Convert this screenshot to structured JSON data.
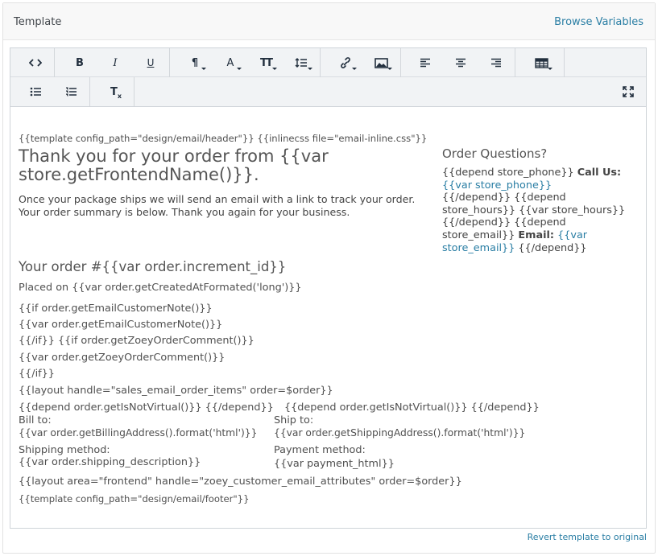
{
  "panel": {
    "title": "Template",
    "browse_variables": "Browse Variables",
    "revert_link": "Revert template to original"
  },
  "toolbar": {
    "row1": [
      {
        "name": "source-code-icon",
        "glyph": "<>"
      },
      {
        "name": "bold-icon",
        "glyph": "B"
      },
      {
        "name": "italic-icon",
        "glyph": "I"
      },
      {
        "name": "underline-icon",
        "glyph": "U"
      },
      {
        "name": "paragraph-format-icon",
        "glyph": "¶"
      },
      {
        "name": "font-color-icon",
        "glyph": "A"
      },
      {
        "name": "font-size-icon",
        "glyph": "TT"
      },
      {
        "name": "line-height-icon",
        "glyph": "≡"
      },
      {
        "name": "link-icon",
        "glyph": "link"
      },
      {
        "name": "image-icon",
        "glyph": "image"
      },
      {
        "name": "align-left-icon",
        "glyph": "align-left"
      },
      {
        "name": "align-center-icon",
        "glyph": "align-center"
      },
      {
        "name": "align-right-icon",
        "glyph": "align-right"
      },
      {
        "name": "table-icon",
        "glyph": "table"
      }
    ],
    "row2": [
      {
        "name": "bullet-list-icon",
        "glyph": "ul"
      },
      {
        "name": "numbered-list-icon",
        "glyph": "ol"
      },
      {
        "name": "clear-formatting-icon",
        "glyph": "Tx"
      },
      {
        "name": "fullscreen-icon",
        "glyph": "expand"
      }
    ]
  },
  "content": {
    "header_line": "{{template config_path=\"design/email/header\"}} {{inlinecss file=\"email-inline.css\"}}",
    "thank_you_line1": "Thank you for your order from {{var",
    "thank_you_line2": "store.getFrontendName()}}.",
    "intro_line1": "Once your package ships we will send an email with a link to track your order.",
    "intro_line2": "Your order summary is below. Thank you again for your business.",
    "order_questions": {
      "title": "Order Questions?",
      "l1_prefix": "{{depend store_phone}} ",
      "l1_bold": "Call Us:",
      "l2_link": "{{var store_phone}}",
      "l3": "{{/depend}} {{depend",
      "l4": "store_hours}} {{var store_hours}}",
      "l5": "{{/depend}} {{depend",
      "l6_prefix": "store_email}} ",
      "l6_bold": "Email:",
      "l6_link": "{{var",
      "l7_link": "store_email}}",
      "l7_suffix": " {{/depend}}"
    },
    "order_title": "Your order #{{var order.increment_id}}",
    "placed_on": "Placed on {{var order.getCreatedAtFormated('long')}}",
    "lines": [
      "{{if order.getEmailCustomerNote()}}",
      "{{var order.getEmailCustomerNote()}}",
      "{{/if}} {{if order.getZoeyOrderComment()}}",
      "{{var order.getZoeyOrderComment()}}",
      "{{/if}}",
      "{{layout handle=\"sales_email_order_items\" order=$order}}"
    ],
    "depend_left": "{{depend order.getIsNotVirtual()}} {{/depend}}",
    "depend_right": "{{depend order.getIsNotVirtual()}} {{/depend}}",
    "bill_to_label": "Bill to:",
    "bill_to_value": "{{var order.getBillingAddress().format('html')}}",
    "ship_to_label": "Ship to:",
    "ship_to_value": "{{var order.getShippingAddress().format('html')}}",
    "shipping_method_label": "Shipping method:",
    "shipping_method_value": "{{var order.shipping_description}}",
    "payment_method_label": "Payment method:",
    "payment_method_value": "{{var payment_html}}",
    "layout_frontend": "{{layout area=\"frontend\" handle=\"zoey_customer_email_attributes\" order=$order}}",
    "footer_line": "{{template config_path=\"design/email/footer\"}}"
  },
  "colors": {
    "link": "#2a7ea4",
    "toolbar_bg": "#f1f3f5",
    "text": "#505050"
  }
}
